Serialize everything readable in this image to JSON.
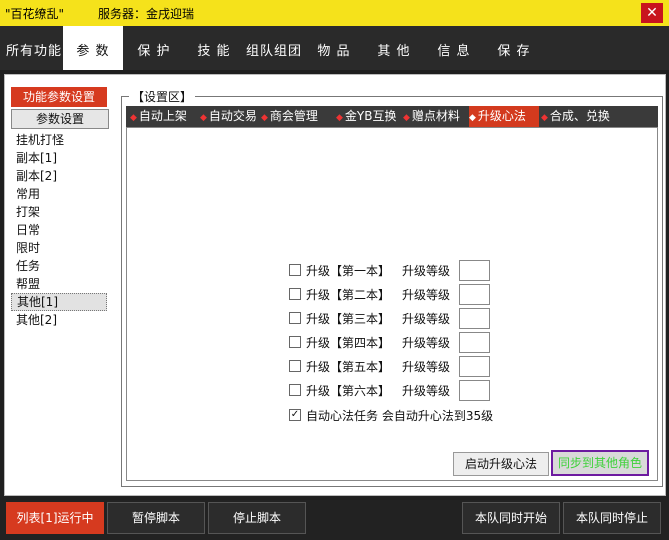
{
  "window": {
    "title_app": "\"百花缭乱\"",
    "title_server": "服务器：金戌迎瑞",
    "close_symbol": "✕"
  },
  "menu": {
    "items": [
      {
        "label": "所有功能"
      },
      {
        "label": "参 数",
        "active": true
      },
      {
        "label": "保 护"
      },
      {
        "label": "技 能"
      },
      {
        "label": "组队组团"
      },
      {
        "label": "物 品"
      },
      {
        "label": "其 他"
      },
      {
        "label": "信 息"
      },
      {
        "label": "保 存"
      }
    ]
  },
  "left": {
    "header": "功能参数设置",
    "button": "参数设置",
    "items": [
      "挂机打怪",
      "副本[1]",
      "副本[2]",
      "常用",
      "打架",
      "日常",
      "限时",
      "任务",
      "帮盟",
      "其他[1]",
      "其他[2]"
    ],
    "selected_index": 9
  },
  "settings": {
    "legend": "【设置区】",
    "tabs": [
      {
        "label": "自动上架"
      },
      {
        "label": "自动交易"
      },
      {
        "label": "商会管理"
      },
      {
        "label": "金YB互换"
      },
      {
        "label": "赠点材料"
      },
      {
        "label": "升级心法",
        "active": true
      },
      {
        "label": "合成、兑换"
      }
    ],
    "rows": [
      {
        "label": "升级【第一本】",
        "level_label": "升级等级",
        "value": "",
        "checked": false
      },
      {
        "label": "升级【第二本】",
        "level_label": "升级等级",
        "value": "",
        "checked": false
      },
      {
        "label": "升级【第三本】",
        "level_label": "升级等级",
        "value": "",
        "checked": false
      },
      {
        "label": "升级【第四本】",
        "level_label": "升级等级",
        "value": "",
        "checked": false
      },
      {
        "label": "升级【第五本】",
        "level_label": "升级等级",
        "value": "",
        "checked": false
      },
      {
        "label": "升级【第六本】",
        "level_label": "升级等级",
        "value": "",
        "checked": false
      }
    ],
    "auto_task": {
      "label": "自动心法任务 会自动升心法到35级",
      "checked": true
    },
    "start_button": "启动升级心法",
    "sync_button": "同步到其他角色"
  },
  "bottom": {
    "run_status": "列表[1]运行中",
    "pause": "暂停脚本",
    "stop": "停止脚本",
    "team_start": "本队同时开始",
    "team_stop": "本队同时停止"
  },
  "colors": {
    "title_bar": "#f5e21b",
    "accent_red": "#d63a1f",
    "sync_border": "#6d1aa0",
    "sync_text": "#3fd23a"
  }
}
